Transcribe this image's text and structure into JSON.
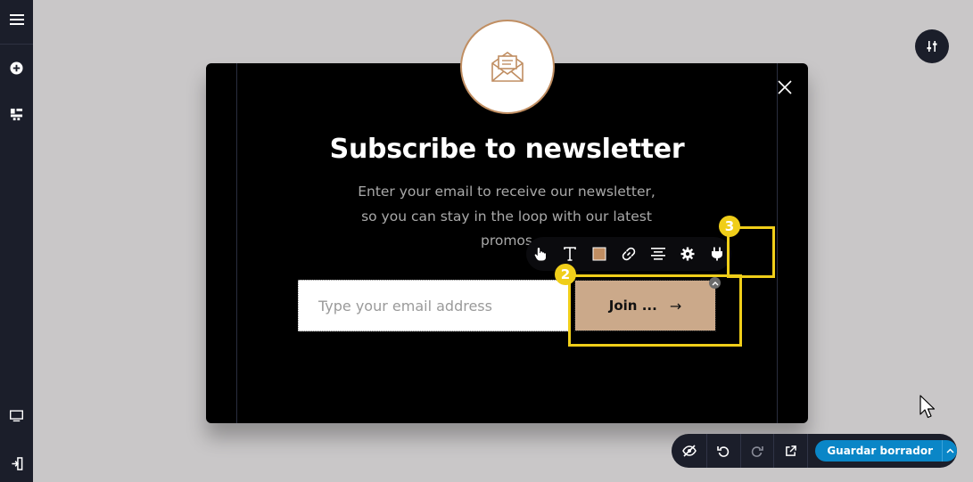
{
  "popup": {
    "title": "Subscribe to newsletter",
    "description": "Enter your email to receive our newsletter, so you can stay in the loop with our latest promos",
    "email_placeholder": "Type your email address",
    "join_label": "Join ...",
    "join_arrow": "→",
    "icon": "envelope-open-icon"
  },
  "toolbar": {
    "items": [
      "hand-pointer-icon",
      "text-icon",
      "color-swatch",
      "link-icon",
      "align-icon",
      "gear-icon",
      "plug-icon"
    ],
    "swatch_color": "#c08e62"
  },
  "annotations": {
    "badge_2": "2",
    "badge_3": "3",
    "color": "#f0ce19"
  },
  "left_bar": [
    "menu-icon",
    "add-icon",
    "widgets-icon",
    "desktop-icon",
    "exit-icon"
  ],
  "bottom_bar": {
    "buttons": [
      "hide-icon",
      "undo-icon",
      "redo-icon",
      "external-link-icon"
    ],
    "save_label": "Guardar borrador",
    "save_color": "#0a86c7"
  }
}
